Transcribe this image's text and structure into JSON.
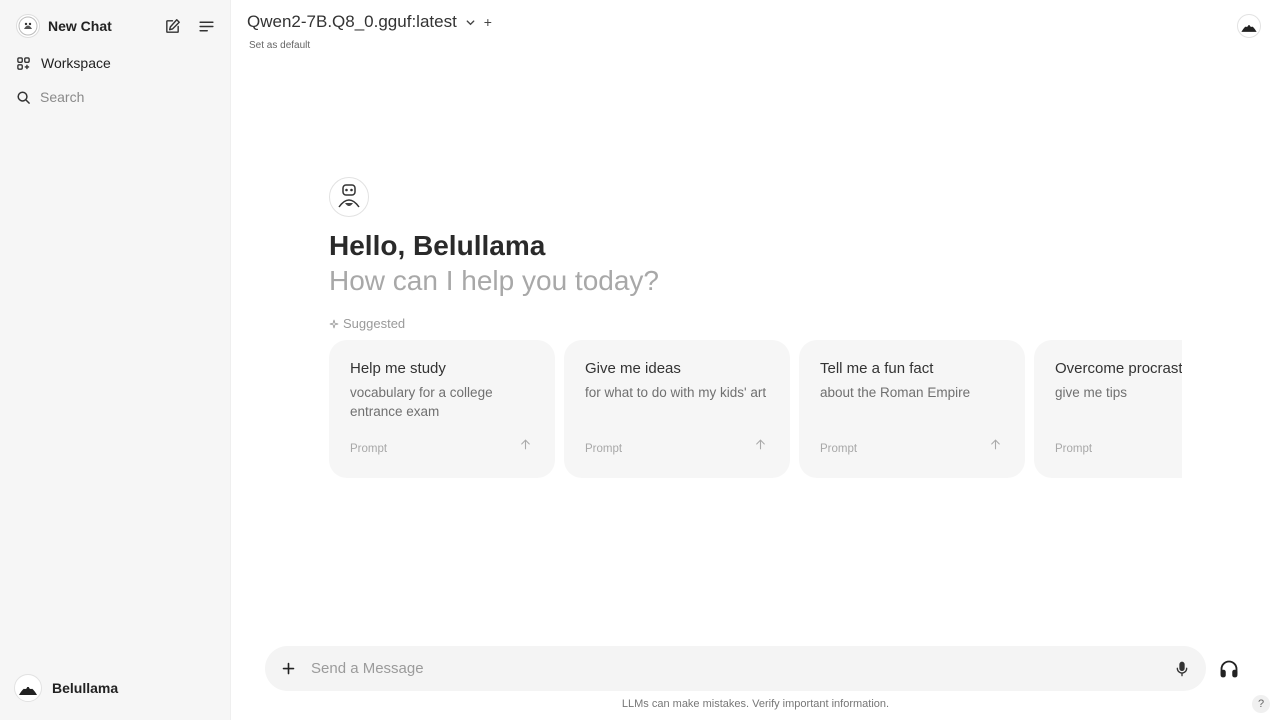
{
  "sidebar": {
    "new_chat_label": "New Chat",
    "workspace_label": "Workspace",
    "search_placeholder": "Search",
    "user_name": "Belullama"
  },
  "header": {
    "model_name": "Qwen2-7B.Q8_0.gguf:latest",
    "set_default_label": "Set as default",
    "add_symbol": "+"
  },
  "hero": {
    "greeting": "Hello, Belullama",
    "subtitle": "How can I help you today?",
    "suggested_label": "Suggested"
  },
  "suggestions": [
    {
      "title": "Help me study",
      "subtitle": "vocabulary for a college entrance exam",
      "tag": "Prompt"
    },
    {
      "title": "Give me ideas",
      "subtitle": "for what to do with my kids' art",
      "tag": "Prompt"
    },
    {
      "title": "Tell me a fun fact",
      "subtitle": "about the Roman Empire",
      "tag": "Prompt"
    },
    {
      "title": "Overcome procrastination",
      "subtitle": "give me tips",
      "tag": "Prompt"
    }
  ],
  "input": {
    "placeholder": "Send a Message"
  },
  "footer": {
    "disclaimer": "LLMs can make mistakes. Verify important information.",
    "help_symbol": "?"
  },
  "colors": {
    "sidebar_bg": "#f6f6f6",
    "card_bg": "#f6f6f6",
    "muted_text": "#a8a8a8"
  }
}
